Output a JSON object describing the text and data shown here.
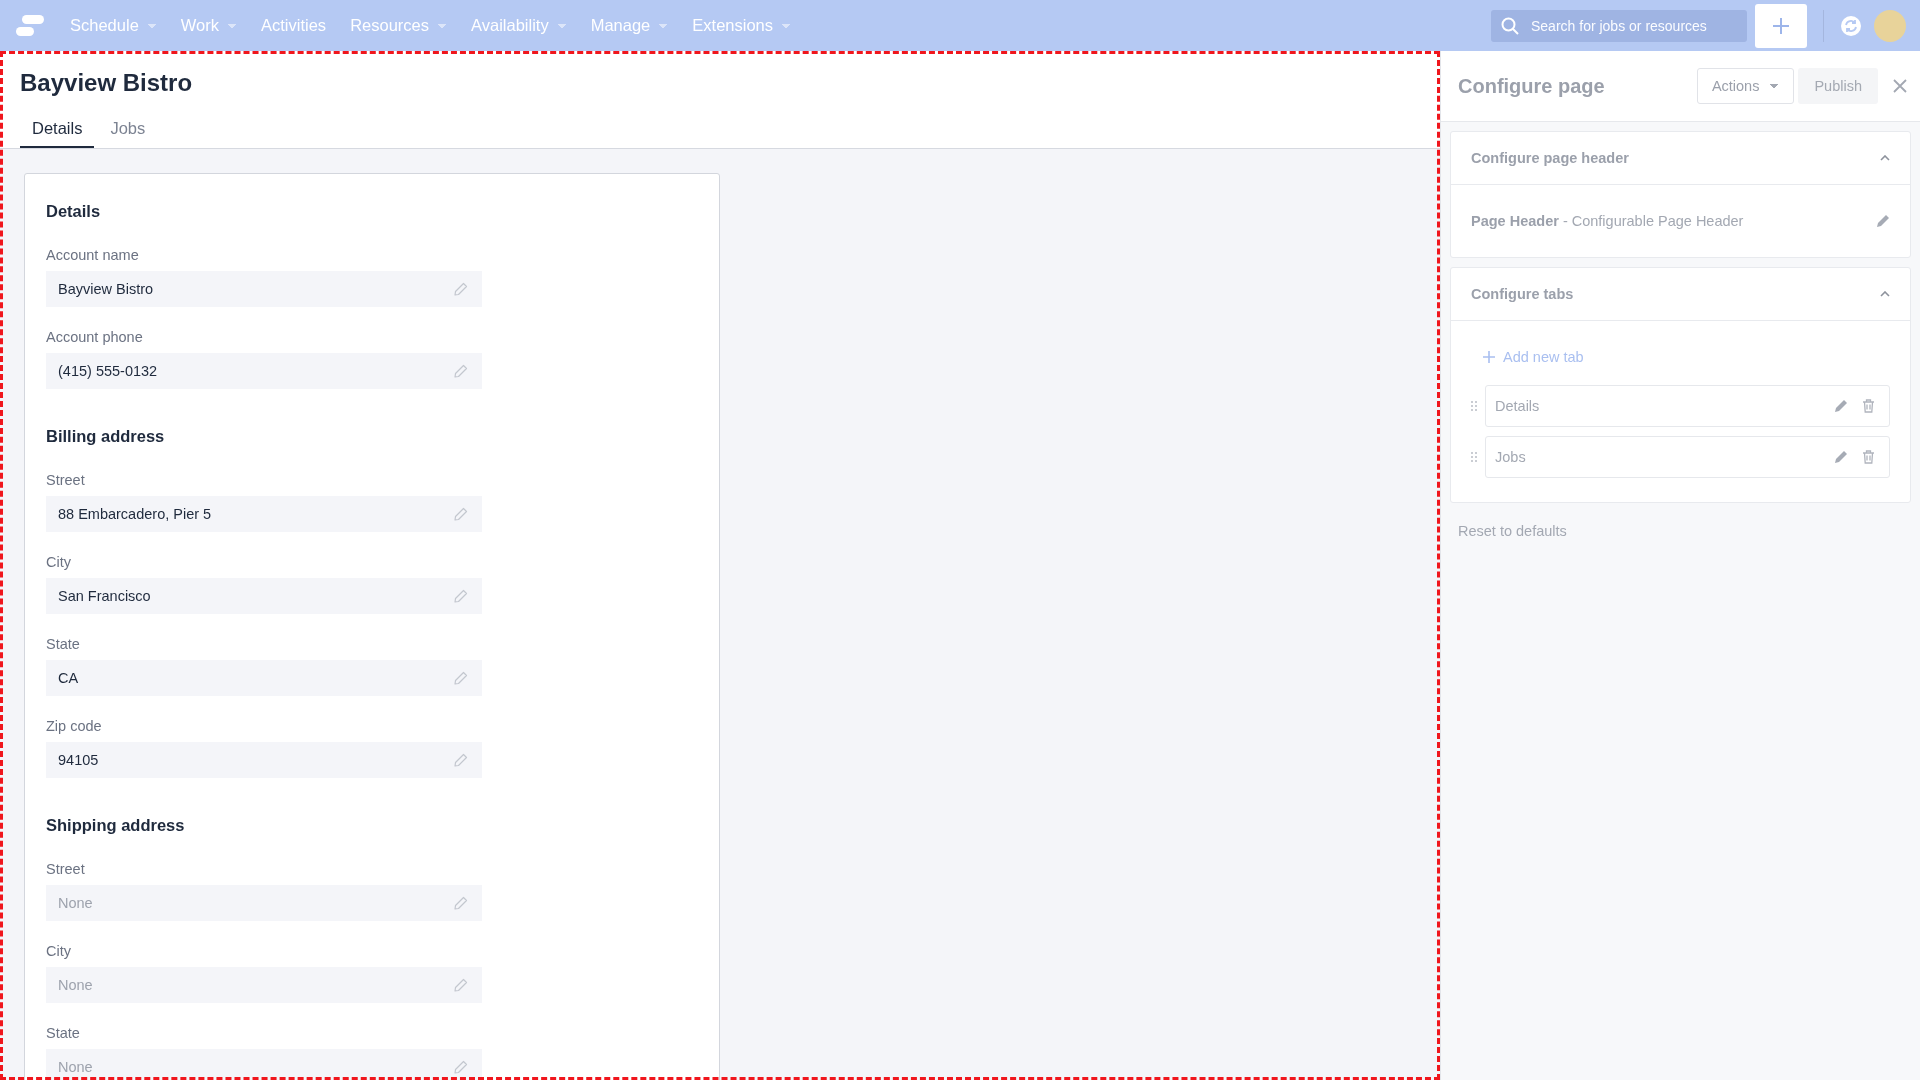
{
  "nav": {
    "items": [
      {
        "label": "Schedule",
        "has_menu": true
      },
      {
        "label": "Work",
        "has_menu": true
      },
      {
        "label": "Activities",
        "has_menu": false
      },
      {
        "label": "Resources",
        "has_menu": true
      },
      {
        "label": "Availability",
        "has_menu": true
      },
      {
        "label": "Manage",
        "has_menu": true
      },
      {
        "label": "Extensions",
        "has_menu": true
      }
    ],
    "search": {
      "placeholder": "Search for jobs or resources"
    }
  },
  "record": {
    "title": "Bayview Bistro",
    "highlighted": true,
    "tabs": [
      {
        "label": "Details",
        "selected": true
      },
      {
        "label": "Jobs",
        "selected": false
      }
    ],
    "sections": [
      {
        "heading": "Details",
        "fields": [
          {
            "label": "Account name",
            "value": "Bayview Bistro"
          },
          {
            "label": "Account phone",
            "value": "(415) 555-0132"
          }
        ]
      },
      {
        "heading": "Billing address",
        "fields": [
          {
            "label": "Street",
            "value": "88 Embarcadero, Pier 5"
          },
          {
            "label": "City",
            "value": "San Francisco"
          },
          {
            "label": "State",
            "value": "CA"
          },
          {
            "label": "Zip code",
            "value": "94105"
          }
        ]
      },
      {
        "heading": "Shipping address",
        "fields": [
          {
            "label": "Street",
            "placeholder": "None"
          },
          {
            "label": "City",
            "placeholder": "None"
          },
          {
            "label": "State",
            "placeholder": "None"
          }
        ]
      }
    ]
  },
  "config_panel": {
    "title": "Configure page",
    "actions_button": "Actions",
    "publish_button": {
      "label": "Publish",
      "disabled": true
    },
    "sections": [
      {
        "kind": "header",
        "title": "Configure page header",
        "expanded": true,
        "item": "**Page Header** - Configurable Page Header"
      },
      {
        "kind": "tabs",
        "title": "Configure tabs",
        "expanded": true,
        "add_link": "Add new tab",
        "tabs": [
          "Details",
          "Jobs"
        ]
      }
    ],
    "reset_link": "Reset to defaults"
  }
}
